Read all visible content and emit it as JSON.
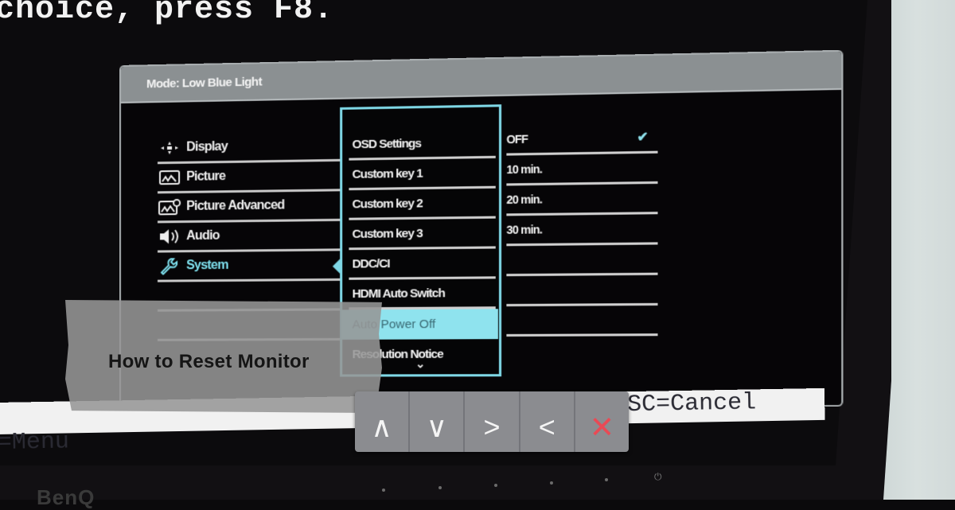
{
  "bios": {
    "line": "choice, press F8."
  },
  "osd": {
    "mode": "Mode: Low Blue Light",
    "main_menu": [
      {
        "label": "Display",
        "icon": "display-icon",
        "active": false
      },
      {
        "label": "Picture",
        "icon": "picture-icon",
        "active": false
      },
      {
        "label": "Picture Advanced",
        "icon": "picture-advanced-icon",
        "active": false
      },
      {
        "label": "Audio",
        "icon": "audio-icon",
        "active": false
      },
      {
        "label": "System",
        "icon": "wrench-icon",
        "active": true
      }
    ],
    "submenu": [
      {
        "label": "OSD Settings"
      },
      {
        "label": "Custom key 1"
      },
      {
        "label": "Custom key 2"
      },
      {
        "label": "Custom key 3"
      },
      {
        "label": "DDC/CI"
      },
      {
        "label": "HDMI Auto Switch"
      },
      {
        "label": "Auto Power Off",
        "selected": true
      },
      {
        "label": "Resolution Notice"
      }
    ],
    "options": [
      {
        "label": "OFF",
        "checked": true
      },
      {
        "label": "10 min."
      },
      {
        "label": "20 min."
      },
      {
        "label": "30 min."
      }
    ]
  },
  "status_bar": {
    "left": "=Menu",
    "right": "SC=Cancel"
  },
  "nav_buttons": [
    {
      "symbol": "∧",
      "name": "up"
    },
    {
      "symbol": "∨",
      "name": "down"
    },
    {
      "symbol": ">",
      "name": "right"
    },
    {
      "symbol": "<",
      "name": "left"
    },
    {
      "symbol": "✕",
      "name": "exit"
    }
  ],
  "banner": {
    "title": "How to Reset Monitor"
  },
  "brand": "BenQ",
  "colors": {
    "accent": "#7fd8e6",
    "selected_bg": "#8fe3ee",
    "exit": "#e94a55",
    "header": "#8b9092"
  }
}
